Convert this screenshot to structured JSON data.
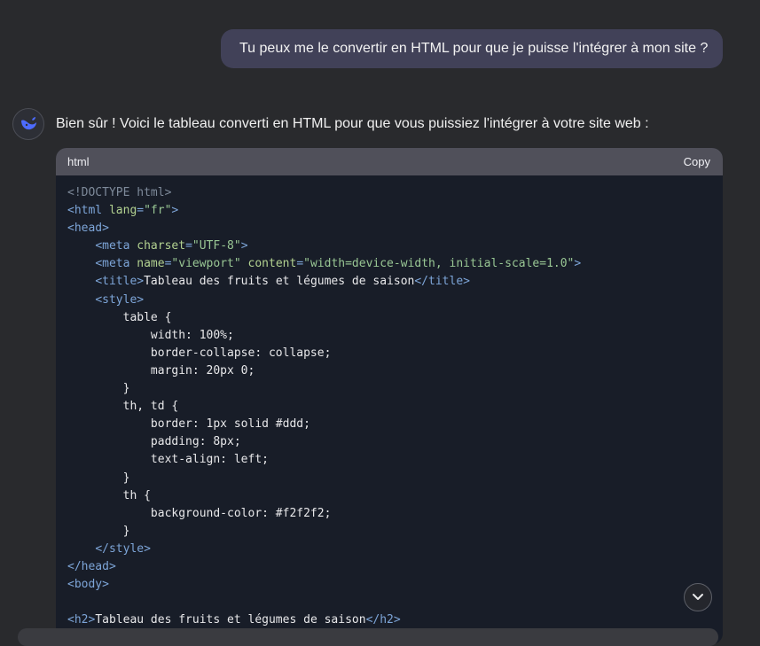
{
  "user_message": "Tu peux me le convertir en HTML pour que je puisse l'intégrer à mon site ?",
  "assistant": {
    "avatar_icon": "whale-logo-icon",
    "intro": "Bien sûr ! Voici le tableau converti en HTML pour que vous puissiez l'intégrer à votre site web :",
    "code_block": {
      "language": "html",
      "copy_label": "Copy",
      "lines": [
        [
          {
            "t": "<!DOCTYPE html>",
            "c": "dt"
          }
        ],
        [
          {
            "t": "<html ",
            "c": "tag"
          },
          {
            "t": "lang",
            "c": "attr"
          },
          {
            "t": "=",
            "c": "tag"
          },
          {
            "t": "\"fr\"",
            "c": "str"
          },
          {
            "t": ">",
            "c": "tag"
          }
        ],
        [
          {
            "t": "<head>",
            "c": "tag"
          }
        ],
        [
          {
            "t": "    "
          },
          {
            "t": "<meta ",
            "c": "tag"
          },
          {
            "t": "charset",
            "c": "attr"
          },
          {
            "t": "=",
            "c": "tag"
          },
          {
            "t": "\"UTF-8\"",
            "c": "str"
          },
          {
            "t": ">",
            "c": "tag"
          }
        ],
        [
          {
            "t": "    "
          },
          {
            "t": "<meta ",
            "c": "tag"
          },
          {
            "t": "name",
            "c": "attr"
          },
          {
            "t": "=",
            "c": "tag"
          },
          {
            "t": "\"viewport\" ",
            "c": "str"
          },
          {
            "t": "content",
            "c": "attr"
          },
          {
            "t": "=",
            "c": "tag"
          },
          {
            "t": "\"width=device-width, initial-scale=1.0\"",
            "c": "str"
          },
          {
            "t": ">",
            "c": "tag"
          }
        ],
        [
          {
            "t": "    "
          },
          {
            "t": "<title>",
            "c": "tag"
          },
          {
            "t": "Tableau des fruits et légumes de saison"
          },
          {
            "t": "</title>",
            "c": "tag"
          }
        ],
        [
          {
            "t": "    "
          },
          {
            "t": "<style>",
            "c": "tag"
          }
        ],
        [
          {
            "t": "        table {"
          }
        ],
        [
          {
            "t": "            width: 100%;"
          }
        ],
        [
          {
            "t": "            border-collapse: collapse;"
          }
        ],
        [
          {
            "t": "            margin: 20px 0;"
          }
        ],
        [
          {
            "t": "        }"
          }
        ],
        [
          {
            "t": "        th, td {"
          }
        ],
        [
          {
            "t": "            border: 1px solid #ddd;"
          }
        ],
        [
          {
            "t": "            padding: 8px;"
          }
        ],
        [
          {
            "t": "            text-align: left;"
          }
        ],
        [
          {
            "t": "        }"
          }
        ],
        [
          {
            "t": "        th {"
          }
        ],
        [
          {
            "t": "            background-color: #f2f2f2;"
          }
        ],
        [
          {
            "t": "        }"
          }
        ],
        [
          {
            "t": "    "
          },
          {
            "t": "</style>",
            "c": "tag"
          }
        ],
        [
          {
            "t": "</head>",
            "c": "tag"
          }
        ],
        [
          {
            "t": "<body>",
            "c": "tag"
          }
        ],
        [],
        [
          {
            "t": "<h2>",
            "c": "tag"
          },
          {
            "t": "Tableau des fruits et légumes de saison"
          },
          {
            "t": "</h2>",
            "c": "tag"
          }
        ]
      ]
    }
  },
  "scroll_button_icon": "chevron-down-icon"
}
